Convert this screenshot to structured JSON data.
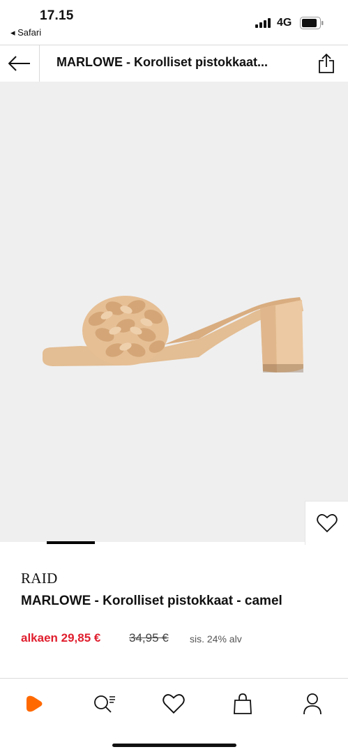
{
  "status_bar": {
    "time": "17.15",
    "back_app": "◂ Safari",
    "network": "4G"
  },
  "header": {
    "title": "MARLOWE - Korolliset pistokkaat..."
  },
  "product": {
    "brand": "RAID",
    "name": "MARLOWE - Korolliset pistokkaat - camel",
    "price": "alkaen 29,85 €",
    "original_price": "34,95 €",
    "vat_note": "sis. 24% alv"
  },
  "tabs": [
    {
      "name": "home",
      "icon": "zalando-play-icon"
    },
    {
      "name": "search",
      "icon": "search-list-icon"
    },
    {
      "name": "wishlist",
      "icon": "heart-icon"
    },
    {
      "name": "bag",
      "icon": "shopping-bag-icon"
    },
    {
      "name": "profile",
      "icon": "person-icon"
    }
  ],
  "colors": {
    "accent": "#ff6900",
    "sale": "#e01e2e",
    "product_bg": "#efefef",
    "shoe": "#e8c49e"
  }
}
